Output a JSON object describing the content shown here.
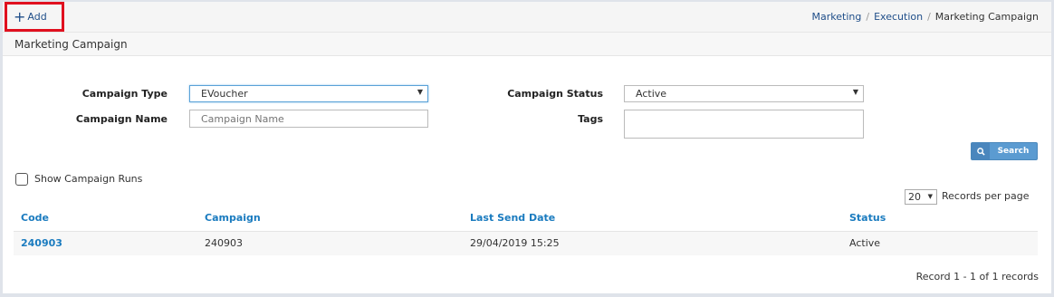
{
  "toolbar": {
    "add_label": "Add"
  },
  "breadcrumb": {
    "items": [
      "Marketing",
      "Execution"
    ],
    "current": "Marketing Campaign"
  },
  "panel": {
    "title": "Marketing Campaign"
  },
  "form": {
    "campaign_type": {
      "label": "Campaign Type",
      "value": "EVoucher"
    },
    "campaign_status": {
      "label": "Campaign Status",
      "value": "Active"
    },
    "campaign_name": {
      "label": "Campaign Name",
      "placeholder": "Campaign Name",
      "value": ""
    },
    "tags": {
      "label": "Tags",
      "value": ""
    },
    "search_label": "Search"
  },
  "show_runs": {
    "label": "Show Campaign Runs",
    "checked": false
  },
  "paging": {
    "page_size": "20",
    "records_per_page_label": "Records per page"
  },
  "table": {
    "columns": [
      "Code",
      "Campaign",
      "Last Send Date",
      "Status"
    ],
    "rows": [
      {
        "code": "240903",
        "campaign": "240903",
        "last_send_date": "29/04/2019 15:25",
        "status": "Active"
      }
    ]
  },
  "footer": {
    "records_text": "Record 1 - 1 of 1 records"
  },
  "colors": {
    "accent": "#1a7bbf",
    "highlight_border": "#e0101f",
    "search_button": "#5b9bd1"
  }
}
